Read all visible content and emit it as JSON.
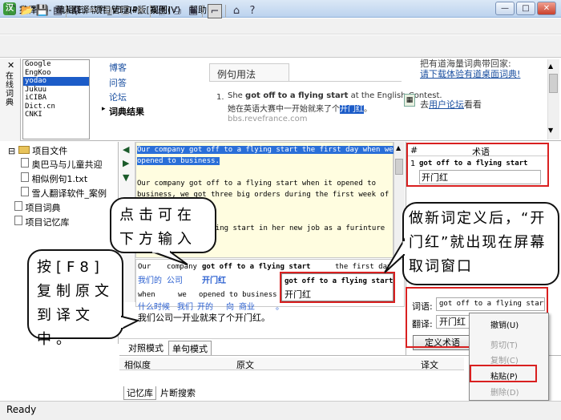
{
  "window": {
    "title": "英译汉 - 雪人翻译软件_V1.04版[案例]",
    "icon_letter": "汉",
    "buttons": [
      "—",
      "□",
      "✕"
    ]
  },
  "menubar": {
    "items": [
      "文件(F)",
      "编辑(E)",
      "项目管理(P)",
      "视图(V)",
      "帮助(H)"
    ]
  },
  "dict_panel": {
    "vertical_label": "在线词典",
    "close_symbol": "✕",
    "engines": [
      "Google",
      "EngKoo",
      "yodao",
      "Jukuu",
      "iCIBA",
      "Dict.cn",
      "CNKI"
    ],
    "selected_engine": "yodao",
    "side_links": [
      "博客",
      "问答",
      "论坛"
    ],
    "result_label": "词典结果",
    "usage_tab": "例句用法",
    "example": {
      "num": "1.",
      "en_pre": "She ",
      "en_bold": "got off to a flying start",
      "en_post": " at the English Contest.",
      "zh_pre": "她在英语大赛中一开始就来了个",
      "zh_hl": "开门红",
      "zh_post": "。",
      "source": "bbs.revefrance.com"
    },
    "right_top": "把有道海量词典带回家:",
    "right_link": "请下载体验有道桌面词典!",
    "right_forum_pre": "去",
    "right_forum_link": "用户论坛",
    "right_forum_post": "看看"
  },
  "tree": {
    "root": "项目文件",
    "files": [
      "奥巴马与儿童共迎",
      "相似例句1.txt",
      "雪人翻译软件_案例"
    ],
    "dict": "项目词典",
    "memory": "项目记忆库"
  },
  "editor": {
    "lines": [
      "Our company got off to a flying start the first day when we",
      "opened to business.",
      "",
      "Our company got off to a flying start when it opened to",
      "business, we got three big orders during the first week of",
      "",
      "lying start in her new job as a furinture"
    ],
    "aligned_en_1": [
      "Our",
      "company",
      "got off to a flying start",
      "the first day"
    ],
    "aligned_zh_1": [
      "我们的",
      "公司",
      "开门红"
    ],
    "aligned_en_2": [
      "when",
      "we",
      "opened to business ."
    ],
    "aligned_zh_2": [
      "什么时候",
      "我们",
      "开的",
      "向",
      "商业",
      "。"
    ],
    "target": "我们公司一开业就来了个开门红。",
    "modes": [
      "对照模式",
      "单句模式"
    ]
  },
  "popup_term": {
    "en": "got off to a flying start",
    "zh": "开门红"
  },
  "terms": {
    "col_num": "#",
    "col_term": "术语",
    "row_num": "1",
    "en": "got off to a flying start",
    "zh": "开门红"
  },
  "define": {
    "label_term": "词语:",
    "value_term": "got off to a flying start",
    "label_trans": "翻译:",
    "value_trans": "开门红",
    "button": "定义术语"
  },
  "context_menu": {
    "items": [
      {
        "label": "撤销(U)",
        "disabled": false
      },
      {
        "label": "剪切(T)",
        "disabled": true
      },
      {
        "label": "复制(C)",
        "disabled": true
      },
      {
        "label": "粘贴(P)",
        "disabled": false
      },
      {
        "label": "删除(D)",
        "disabled": true
      }
    ]
  },
  "memory": {
    "headers": [
      "相似度",
      "原文",
      "译文"
    ],
    "tabs": [
      "记忆库",
      "片断搜索"
    ]
  },
  "status": "Ready",
  "callouts": {
    "center": "点击可在下方输入",
    "left": "按[F8]复制原文到译文中。",
    "right": "做新词定义后，“开门红”就出现在屏幕取词窗口"
  },
  "colors": {
    "highlight": "#2a6fd8",
    "annotation_red": "#d92020",
    "editor_bg": "#fffde0"
  }
}
